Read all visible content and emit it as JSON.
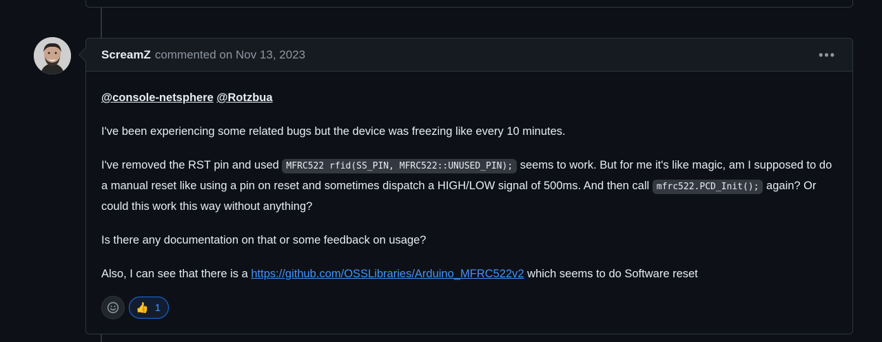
{
  "comment": {
    "author": "ScreamZ",
    "meta": "commented on Nov 13, 2023",
    "more_icon": "kebab-horizontal-icon",
    "mentions": [
      "@console-netsphere",
      "@Rotzbua"
    ],
    "p1": "I've been experiencing some related bugs but the device was freezing like every 10 minutes.",
    "p2_a": "I've removed the RST pin and used ",
    "p2_code1": "MFRC522 rfid(SS_PIN, MFRC522::UNUSED_PIN);",
    "p2_b": " seems to work. But for me it's like magic, am I supposed to do a manual reset like using a pin on reset and sometimes dispatch a HIGH/LOW signal of 500ms. And then call ",
    "p2_code2": "mfrc522.PCD_Init();",
    "p2_c": " again? Or could this work this way without anything?",
    "p3": "Is there any documentation on that or some feedback on usage?",
    "p4_a": "Also, I can see that there is a ",
    "p4_link": "https://github.com/OSSLibraries/Arduino_MFRC522v2",
    "p4_b": " which seems to do Software reset"
  },
  "reactions": {
    "add_icon": "smiley-icon",
    "thumbs_up": {
      "emoji": "👍",
      "count": "1"
    }
  },
  "colors": {
    "background": "#0d1117",
    "header": "#161b22",
    "border": "#30363d",
    "link": "#4493f8",
    "muted": "#8d96a0"
  }
}
